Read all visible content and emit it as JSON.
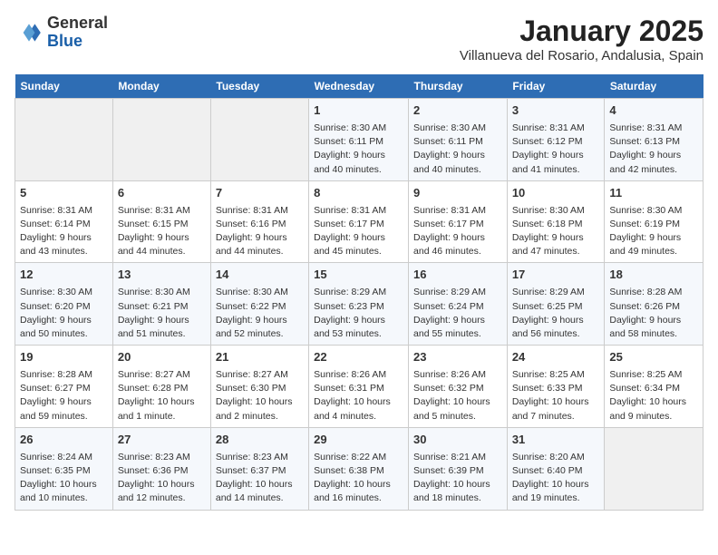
{
  "header": {
    "logo_general": "General",
    "logo_blue": "Blue",
    "month_title": "January 2025",
    "subtitle": "Villanueva del Rosario, Andalusia, Spain"
  },
  "days_of_week": [
    "Sunday",
    "Monday",
    "Tuesday",
    "Wednesday",
    "Thursday",
    "Friday",
    "Saturday"
  ],
  "weeks": [
    [
      {
        "day": "",
        "content": ""
      },
      {
        "day": "",
        "content": ""
      },
      {
        "day": "",
        "content": ""
      },
      {
        "day": "1",
        "content": "Sunrise: 8:30 AM\nSunset: 6:11 PM\nDaylight: 9 hours\nand 40 minutes."
      },
      {
        "day": "2",
        "content": "Sunrise: 8:30 AM\nSunset: 6:11 PM\nDaylight: 9 hours\nand 40 minutes."
      },
      {
        "day": "3",
        "content": "Sunrise: 8:31 AM\nSunset: 6:12 PM\nDaylight: 9 hours\nand 41 minutes."
      },
      {
        "day": "4",
        "content": "Sunrise: 8:31 AM\nSunset: 6:13 PM\nDaylight: 9 hours\nand 42 minutes."
      }
    ],
    [
      {
        "day": "5",
        "content": "Sunrise: 8:31 AM\nSunset: 6:14 PM\nDaylight: 9 hours\nand 43 minutes."
      },
      {
        "day": "6",
        "content": "Sunrise: 8:31 AM\nSunset: 6:15 PM\nDaylight: 9 hours\nand 44 minutes."
      },
      {
        "day": "7",
        "content": "Sunrise: 8:31 AM\nSunset: 6:16 PM\nDaylight: 9 hours\nand 44 minutes."
      },
      {
        "day": "8",
        "content": "Sunrise: 8:31 AM\nSunset: 6:17 PM\nDaylight: 9 hours\nand 45 minutes."
      },
      {
        "day": "9",
        "content": "Sunrise: 8:31 AM\nSunset: 6:17 PM\nDaylight: 9 hours\nand 46 minutes."
      },
      {
        "day": "10",
        "content": "Sunrise: 8:30 AM\nSunset: 6:18 PM\nDaylight: 9 hours\nand 47 minutes."
      },
      {
        "day": "11",
        "content": "Sunrise: 8:30 AM\nSunset: 6:19 PM\nDaylight: 9 hours\nand 49 minutes."
      }
    ],
    [
      {
        "day": "12",
        "content": "Sunrise: 8:30 AM\nSunset: 6:20 PM\nDaylight: 9 hours\nand 50 minutes."
      },
      {
        "day": "13",
        "content": "Sunrise: 8:30 AM\nSunset: 6:21 PM\nDaylight: 9 hours\nand 51 minutes."
      },
      {
        "day": "14",
        "content": "Sunrise: 8:30 AM\nSunset: 6:22 PM\nDaylight: 9 hours\nand 52 minutes."
      },
      {
        "day": "15",
        "content": "Sunrise: 8:29 AM\nSunset: 6:23 PM\nDaylight: 9 hours\nand 53 minutes."
      },
      {
        "day": "16",
        "content": "Sunrise: 8:29 AM\nSunset: 6:24 PM\nDaylight: 9 hours\nand 55 minutes."
      },
      {
        "day": "17",
        "content": "Sunrise: 8:29 AM\nSunset: 6:25 PM\nDaylight: 9 hours\nand 56 minutes."
      },
      {
        "day": "18",
        "content": "Sunrise: 8:28 AM\nSunset: 6:26 PM\nDaylight: 9 hours\nand 58 minutes."
      }
    ],
    [
      {
        "day": "19",
        "content": "Sunrise: 8:28 AM\nSunset: 6:27 PM\nDaylight: 9 hours\nand 59 minutes."
      },
      {
        "day": "20",
        "content": "Sunrise: 8:27 AM\nSunset: 6:28 PM\nDaylight: 10 hours\nand 1 minute."
      },
      {
        "day": "21",
        "content": "Sunrise: 8:27 AM\nSunset: 6:30 PM\nDaylight: 10 hours\nand 2 minutes."
      },
      {
        "day": "22",
        "content": "Sunrise: 8:26 AM\nSunset: 6:31 PM\nDaylight: 10 hours\nand 4 minutes."
      },
      {
        "day": "23",
        "content": "Sunrise: 8:26 AM\nSunset: 6:32 PM\nDaylight: 10 hours\nand 5 minutes."
      },
      {
        "day": "24",
        "content": "Sunrise: 8:25 AM\nSunset: 6:33 PM\nDaylight: 10 hours\nand 7 minutes."
      },
      {
        "day": "25",
        "content": "Sunrise: 8:25 AM\nSunset: 6:34 PM\nDaylight: 10 hours\nand 9 minutes."
      }
    ],
    [
      {
        "day": "26",
        "content": "Sunrise: 8:24 AM\nSunset: 6:35 PM\nDaylight: 10 hours\nand 10 minutes."
      },
      {
        "day": "27",
        "content": "Sunrise: 8:23 AM\nSunset: 6:36 PM\nDaylight: 10 hours\nand 12 minutes."
      },
      {
        "day": "28",
        "content": "Sunrise: 8:23 AM\nSunset: 6:37 PM\nDaylight: 10 hours\nand 14 minutes."
      },
      {
        "day": "29",
        "content": "Sunrise: 8:22 AM\nSunset: 6:38 PM\nDaylight: 10 hours\nand 16 minutes."
      },
      {
        "day": "30",
        "content": "Sunrise: 8:21 AM\nSunset: 6:39 PM\nDaylight: 10 hours\nand 18 minutes."
      },
      {
        "day": "31",
        "content": "Sunrise: 8:20 AM\nSunset: 6:40 PM\nDaylight: 10 hours\nand 19 minutes."
      },
      {
        "day": "",
        "content": ""
      }
    ]
  ]
}
